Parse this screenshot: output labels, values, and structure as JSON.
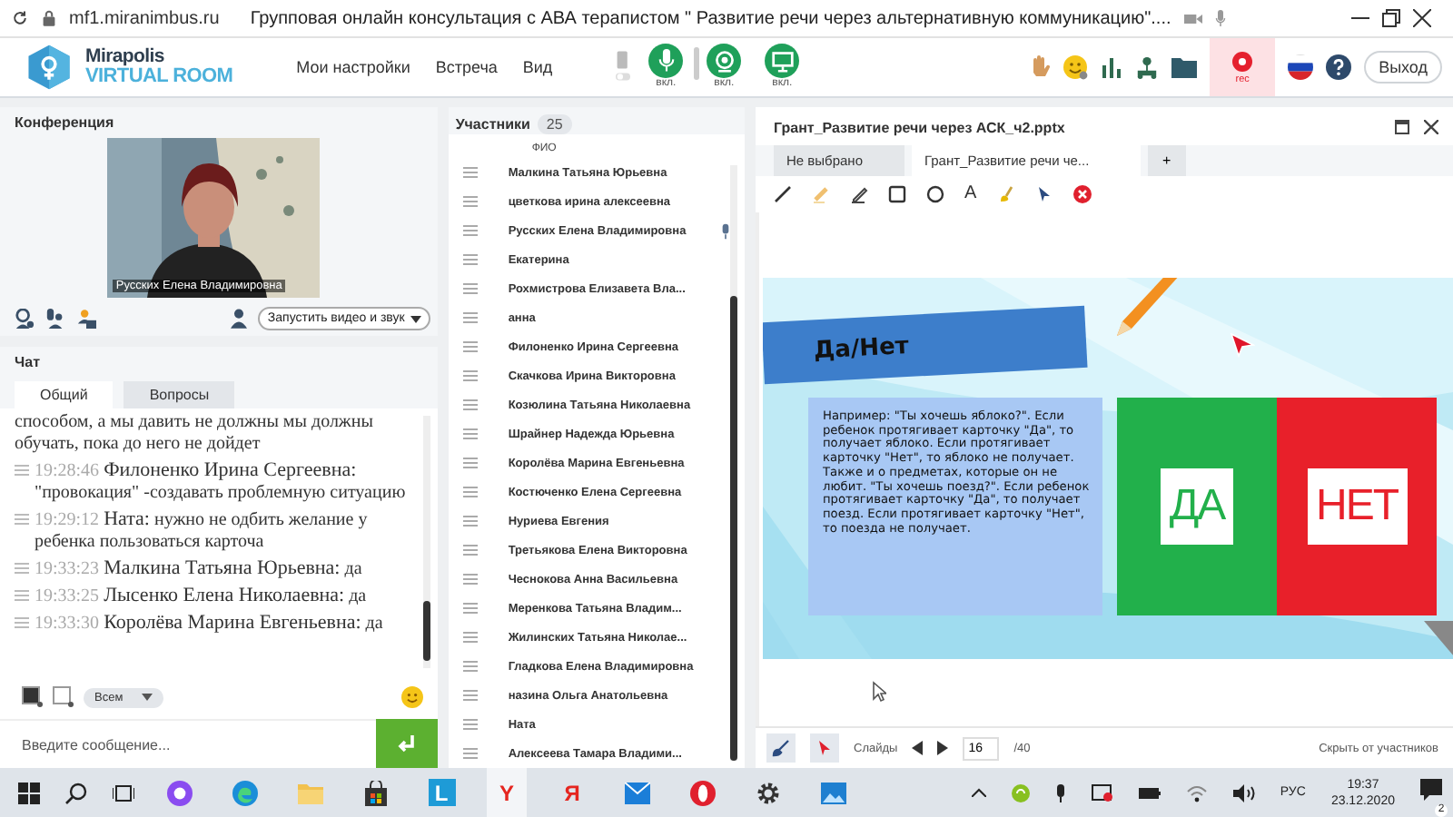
{
  "browser": {
    "address": "mf1.miranimbus.ru",
    "title": "Групповая онлайн консультация с АВА терапистом \" Развитие речи через альтернативную коммуникацию\"...."
  },
  "header": {
    "logo_top": "Mirapolis",
    "logo_bottom": "VIRTUAL ROOM",
    "menu": [
      "Мои настройки",
      "Встреча",
      "Вид"
    ],
    "media": [
      {
        "kind": "mic",
        "label": "вкл.",
        "on": true
      },
      {
        "kind": "camera",
        "label": "вкл.",
        "on": true
      },
      {
        "kind": "screen",
        "label": "вкл.",
        "on": true
      }
    ],
    "rec": "rec",
    "exit": "Выход"
  },
  "conference": {
    "title": "Конференция",
    "video": {
      "kind": "picture",
      "caption": "Русских Елена Владимировна"
    },
    "start_button": "Запустить видео и звук"
  },
  "chat": {
    "title": "Чат",
    "tabs": [
      {
        "label": "Общий",
        "selected": true
      },
      {
        "label": "Вопросы",
        "selected": false
      }
    ],
    "messages": [
      {
        "kind": "continuation",
        "text": "способом, а мы давить не должны мы должны обучать, пока до него не дойдет"
      },
      {
        "kind": "message",
        "time": "19:28:46",
        "author": "Филоненко Ирина  Сергеевна:",
        "text": "\"провокация\" -создавать проблемную ситуацию"
      },
      {
        "kind": "message",
        "time": "19:29:12",
        "author": "Ната:",
        "text": "нужно не одбить желание у ребенка пользоваться карточа"
      },
      {
        "kind": "message",
        "time": "19:33:23",
        "author": "Малкина Татьяна  Юрьевна:",
        "text": "да"
      },
      {
        "kind": "message",
        "time": "19:33:25",
        "author": "Лысенко Елена  Николаевна:",
        "text": "да"
      },
      {
        "kind": "message",
        "time": "19:33:30",
        "author": "Королёва Марина Евгеньевна:",
        "text": "да"
      }
    ],
    "recipient": "Всем",
    "placeholder": "Введите сообщение..."
  },
  "participants": {
    "title": "Участники",
    "count": "25",
    "column": "ФИО",
    "rows": [
      {
        "name": "Малкина Татьяна  Юрьевна",
        "mic": false
      },
      {
        "name": "цветкова  ирина алексеевна",
        "mic": false
      },
      {
        "name": "Русских Елена Владимировна",
        "mic": true
      },
      {
        "name": "Екатерина",
        "mic": false
      },
      {
        "name": "Рохмистрова  Елизавета Вла...",
        "mic": false
      },
      {
        "name": "анна",
        "mic": false
      },
      {
        "name": "Филоненко Ирина  Сергеевна",
        "mic": false
      },
      {
        "name": "Скачкова  Ирина Викторовна",
        "mic": false
      },
      {
        "name": "Козюлина  Татьяна Николаевна",
        "mic": false
      },
      {
        "name": "Шрайнер Надежда  Юрьевна",
        "mic": false
      },
      {
        "name": "Королёва Марина Евгеньевна",
        "mic": false
      },
      {
        "name": "Костюченко  Елена Сергеевна",
        "mic": false
      },
      {
        "name": "Нуриева Евгения",
        "mic": false
      },
      {
        "name": "Третьякова  Елена Викторовна",
        "mic": false
      },
      {
        "name": "Чеснокова  Анна  Васильевна",
        "mic": false
      },
      {
        "name": "Меренкова  Татьяна  Владим...",
        "mic": false
      },
      {
        "name": "Жилинских  Татьяна Николае...",
        "mic": false
      },
      {
        "name": "Гладкова Елена Владимировна",
        "mic": false
      },
      {
        "name": "назина  Ольга  Анатольевна",
        "mic": false
      },
      {
        "name": "Ната",
        "mic": false
      },
      {
        "name": "Алексеева   Тамара  Владими...",
        "mic": false
      }
    ]
  },
  "presentation": {
    "title": "Грант_Развитие речи через АСК_ч2.pptx",
    "tabs": [
      {
        "label": "Не выбрано",
        "selected": false
      },
      {
        "label": "Грант_Развитие речи че...",
        "selected": true
      }
    ],
    "add": "+",
    "tools": [
      {
        "kind": "line"
      },
      {
        "kind": "highlighter"
      },
      {
        "kind": "pen"
      },
      {
        "kind": "rect"
      },
      {
        "kind": "circle"
      },
      {
        "kind": "text",
        "label": "A"
      },
      {
        "kind": "brush"
      },
      {
        "kind": "pointer"
      },
      {
        "kind": "clear"
      }
    ],
    "slide": {
      "title": "Да/Нет",
      "text": "Например: \"Ты хочешь яблоко?\". Если ребенок протягивает карточку \"Да\", то получает яблоко. Если протягивает карточку \"Нет\", то яблоко не получает. Также и о предметах, которые он не любит. \"Ты хочешь поезд?\". Если ребенок протягивает карточку \"Да\", то получает поезд. Если протягивает карточку \"Нет\", то поезда не получает.",
      "cards": [
        {
          "label": "ДА",
          "color": "#22b04b"
        },
        {
          "label": "НЕТ",
          "color": "#e8202a"
        }
      ]
    },
    "slides_label": "Слайды",
    "page": "16",
    "total": "/40",
    "hide": "Скрыть от участников"
  },
  "taskbar": {
    "apps": [
      {
        "kind": "alice",
        "active": false
      },
      {
        "kind": "edge",
        "active": false
      },
      {
        "kind": "folder",
        "active": false
      },
      {
        "kind": "store",
        "active": false
      },
      {
        "kind": "letter",
        "glyph": "L",
        "color": "#1e9bd7",
        "active": false
      },
      {
        "kind": "letter",
        "glyph": "Y",
        "color": "#e52620",
        "active": true
      },
      {
        "kind": "letter",
        "glyph": "Я",
        "color": "#e52620",
        "active": false
      },
      {
        "kind": "mail",
        "active": false
      },
      {
        "kind": "opera",
        "active": false
      },
      {
        "kind": "gear",
        "active": false
      },
      {
        "kind": "photos",
        "active": false
      }
    ],
    "lang": "РУС",
    "time": "19:37",
    "date": "23.12.2020",
    "notifications": "2"
  }
}
